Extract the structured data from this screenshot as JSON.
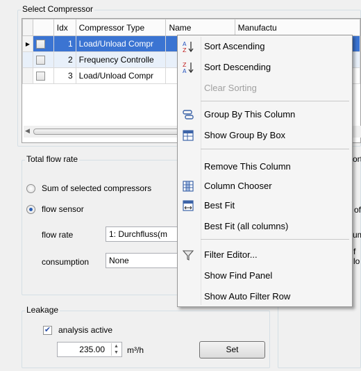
{
  "select_compressor": {
    "title": "Select Compressor",
    "columns": [
      "Idx",
      "Compressor Type",
      "Name",
      "Manufactu"
    ],
    "rows": [
      {
        "idx": "1",
        "type": "Load/Unload Compr"
      },
      {
        "idx": "2",
        "type": "Frequency Controlle"
      },
      {
        "idx": "3",
        "type": "Load/Unload Compr"
      }
    ],
    "selected_row_color": "#3b74d2"
  },
  "total_flow": {
    "title": "Total flow rate",
    "option_sum": "Sum of selected compressors",
    "option_sensor": "flow sensor",
    "flow_rate_label": "flow rate",
    "flow_rate_value": "1: Durchfluss(m",
    "consumption_label": "consumption",
    "consumption_value": "None"
  },
  "right_panel": {
    "frag1": "ort",
    "frag2": "of",
    "frag3": "um",
    "frag4": "f lo"
  },
  "leakage": {
    "title": "Leakage",
    "analysis_label": "analysis active",
    "analysis_checked": true,
    "amount": "235.00",
    "unit": "m³/h",
    "set_label": "Set"
  },
  "context_menu": {
    "sort_asc": "Sort Ascending",
    "sort_desc": "Sort Descending",
    "clear_sort": "Clear Sorting",
    "group_by": "Group By This Column",
    "show_group_box": "Show Group By Box",
    "remove_column": "Remove This Column",
    "column_chooser": "Column Chooser",
    "best_fit": "Best Fit",
    "best_fit_all": "Best Fit (all columns)",
    "filter_editor": "Filter Editor...",
    "show_find": "Show Find Panel",
    "show_auto_filter": "Show Auto Filter Row"
  }
}
